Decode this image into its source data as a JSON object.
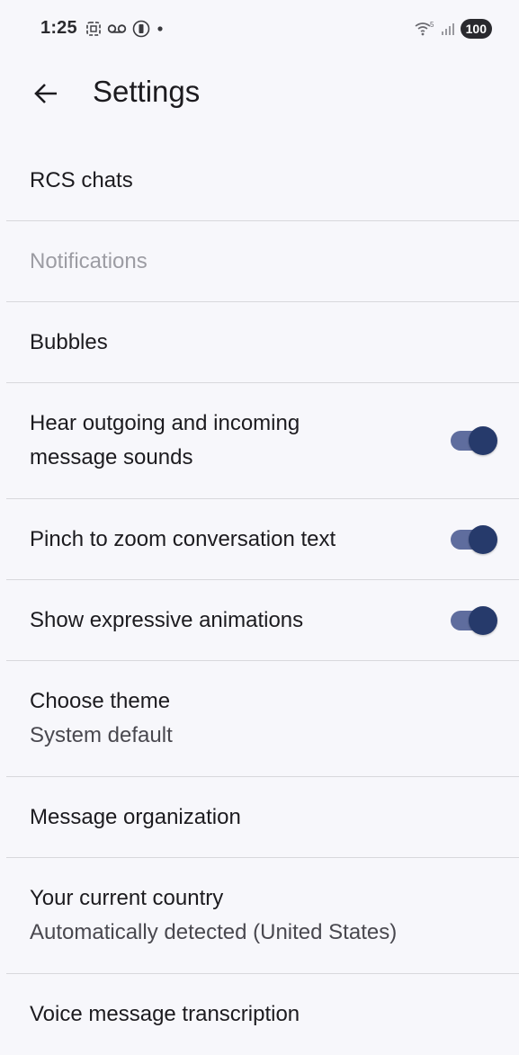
{
  "status_bar": {
    "time": "1:25",
    "battery": "100",
    "network_label": "5"
  },
  "app_bar": {
    "title": "Settings"
  },
  "settings": [
    {
      "title": "RCS chats"
    },
    {
      "title": "Notifications"
    },
    {
      "title": "Bubbles"
    },
    {
      "title": "Hear outgoing and incoming message sounds",
      "toggle_on": true
    },
    {
      "title": "Pinch to zoom conversation text",
      "toggle_on": true
    },
    {
      "title": "Show expressive animations",
      "toggle_on": true
    },
    {
      "title": "Choose theme",
      "subtitle": "System default"
    },
    {
      "title": "Message organization"
    },
    {
      "title": "Your current country",
      "subtitle": "Automatically detected (United States)"
    },
    {
      "title": "Voice message transcription"
    }
  ],
  "colors": {
    "background": "#f7f7fb",
    "toggle_track": "#5f6d9e",
    "toggle_thumb": "#263a6b",
    "disabled_text": "#9c9ca3",
    "divider": "#d8d8dc"
  }
}
